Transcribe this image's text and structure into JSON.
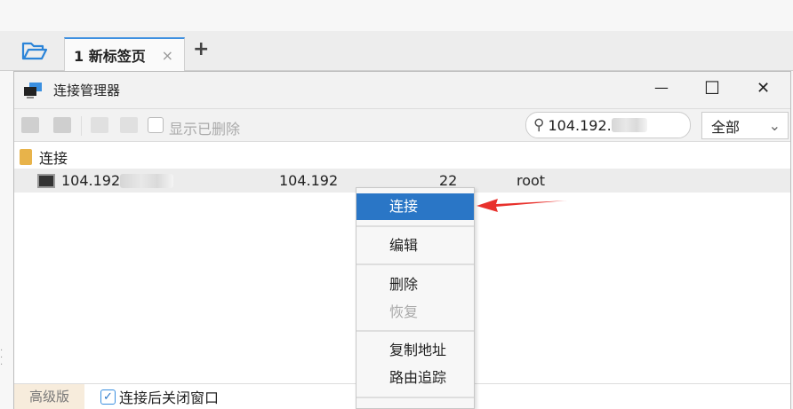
{
  "tabs": {
    "active": "1 新标签页",
    "close": "×",
    "add": "+"
  },
  "window": {
    "title": "连接管理器",
    "minimize": "—",
    "maximize": "☐",
    "close": "✕"
  },
  "toolbar": {
    "show_deleted": "显示已删除",
    "search_value": "104.192.",
    "filter": "全部"
  },
  "tree": {
    "folder": "连接",
    "rows": [
      {
        "name": "104.192",
        "host": "104.192",
        "port": "22",
        "user": "root"
      }
    ]
  },
  "context_menu": {
    "items": [
      {
        "label": "连接",
        "highlighted": true
      },
      {
        "label": "编辑"
      },
      {
        "label": "删除"
      },
      {
        "label": "恢复",
        "disabled": true
      },
      {
        "label": "复制地址"
      },
      {
        "label": "路由追踪"
      }
    ]
  },
  "bottom": {
    "edition": "高级版",
    "close_after_connect": "连接后关闭窗口",
    "close_after_connect_checked": true
  },
  "colors": {
    "accent": "#2a76c6",
    "arrow": "#e8312c"
  }
}
